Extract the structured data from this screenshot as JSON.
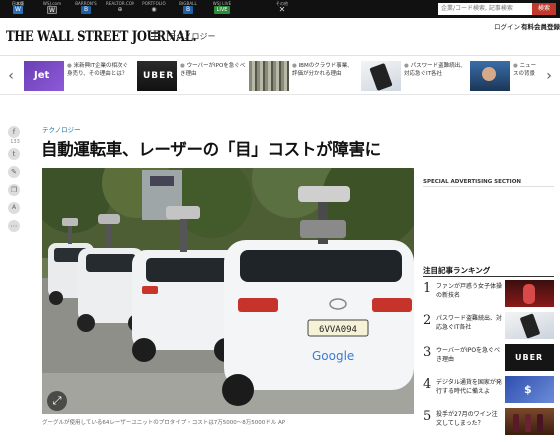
{
  "network": {
    "items": [
      {
        "label": "日本版",
        "icon": "wsj-icon",
        "active": true
      },
      {
        "label": "WSJ.com",
        "icon": "wsj-icon",
        "active": false
      },
      {
        "label": "BARRON'S",
        "icon": "barrons-icon",
        "active": false
      },
      {
        "label": "REALTOR.COM",
        "icon": "realtor-icon",
        "active": false
      },
      {
        "label": "PORTFOLIO",
        "icon": "portfolio-icon",
        "active": false
      },
      {
        "label": "BIGBALL",
        "icon": "bigball-icon",
        "active": false
      },
      {
        "label": "WSJ LIVE",
        "icon": "wsj-live-icon",
        "active": false
      },
      {
        "label": "その他",
        "icon": "more-icon",
        "active": false
      }
    ],
    "search_placeholder": "企業/コード検索, 記事検索",
    "search_button": "検索"
  },
  "masthead": {
    "logo": "THE WALL STREET JOURNAL.",
    "section": "テクノロジー",
    "login": "ログイン",
    "subscribe": "有料会員登録"
  },
  "carousel": {
    "items": [
      {
        "thumb_text": "Jet",
        "text": "米新興IT企業の相次ぐ身売り、その理由とは？"
      },
      {
        "thumb_text": "UBER",
        "text": "ウーバーがIPOを急ぐべき理由"
      },
      {
        "thumb_text": "",
        "text": "IBMのクラウド事業、評価が分かれる理由"
      },
      {
        "thumb_text": "",
        "text": "パスワード盗難続出、対応急ぐIT各社"
      },
      {
        "thumb_text": "",
        "text": "ニュースの背景"
      }
    ]
  },
  "share": {
    "count": "133"
  },
  "article": {
    "kicker": "テクノロジー",
    "headline": "自動運転車、レーザーの「目」コストが障害に",
    "caption": "グーグルが使用している64レーザーユニットのプロタイプ・コストは7万5000～8万5000ドル AP"
  },
  "sidebar": {
    "ad_label": "SPECIAL ADVERTISING SECTION",
    "ranking_title": "注目記事ランキング",
    "ranking": [
      {
        "num": "1",
        "text": "ファンが戸惑う女子体操の新技名",
        "thumb": ""
      },
      {
        "num": "2",
        "text": "パスワード盗難続出、対応急ぐIT各社",
        "thumb": ""
      },
      {
        "num": "3",
        "text": "ウーバーがIPOを急ぐべき理由",
        "thumb": "UBER"
      },
      {
        "num": "4",
        "text": "デジタル通貨を国家が発行する時代に備えよ",
        "thumb": "$"
      },
      {
        "num": "5",
        "text": "投手が27月のワイン注文してしまった？",
        "thumb": ""
      }
    ]
  },
  "photo": {
    "plate": "6VVA094",
    "brand": "Google"
  },
  "colors": {
    "accent": "#c0392b",
    "kicker": "#1a6fa0",
    "topbar": "#111111"
  }
}
